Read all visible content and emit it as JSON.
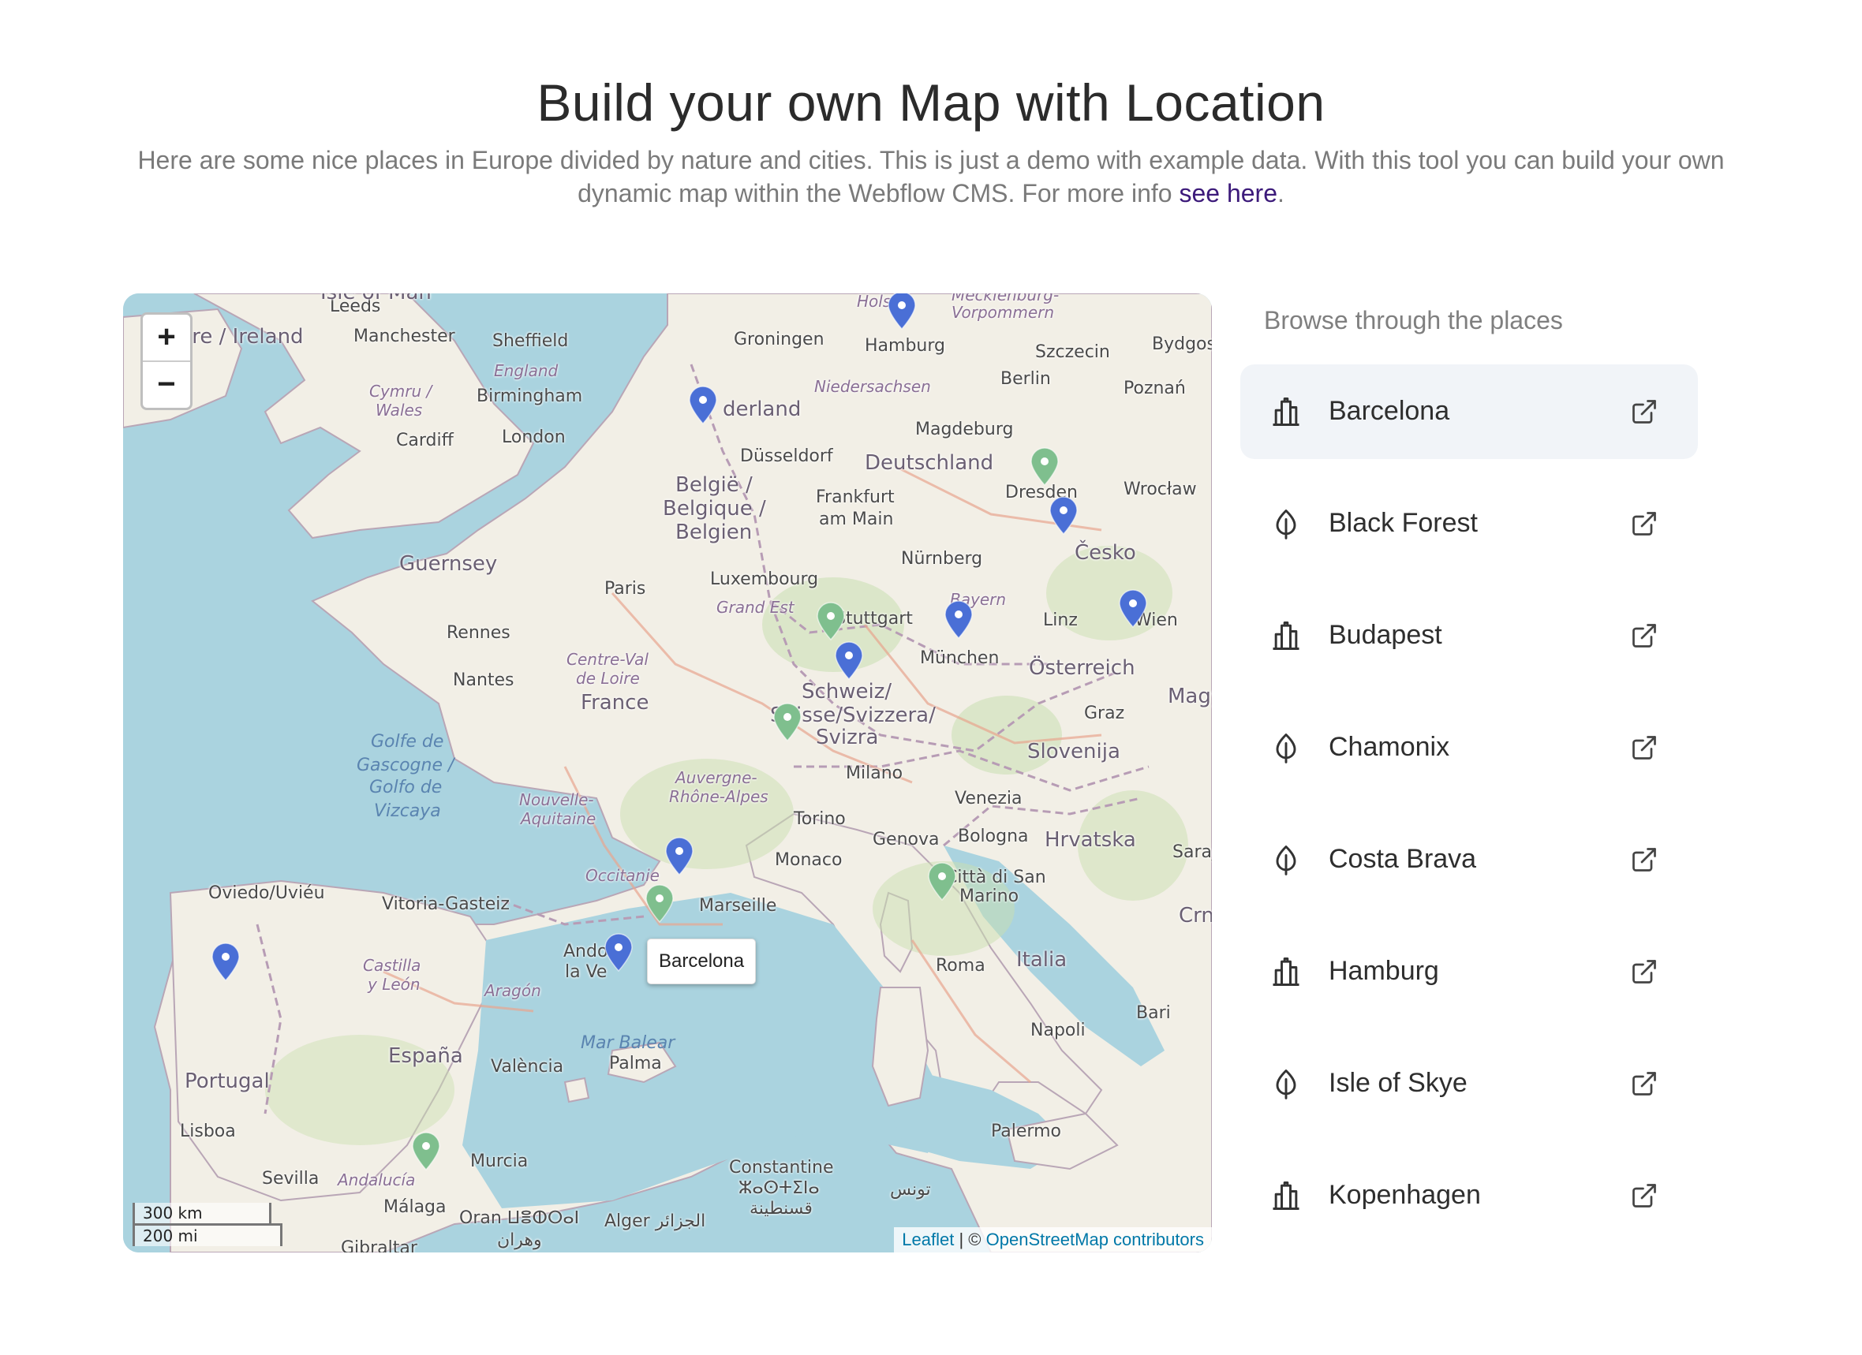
{
  "header": {
    "title": "Build your own Map with Location",
    "subtitle_before": "Here are some nice places in Europe divided by nature and cities. This is just a demo with example data. With this tool you can build your own dynamic map within the Webflow CMS. For more info ",
    "link_text": "see here",
    "subtitle_after": "."
  },
  "map": {
    "zoom_in": "+",
    "zoom_out": "−",
    "scale_km": "300 km",
    "scale_mi": "200 mi",
    "attribution_leaflet": "Leaflet",
    "attribution_sep": " | © ",
    "attribution_osm": "OpenStreetMap contributors",
    "tooltip": "Barcelona",
    "city_color": "#4a6fd6",
    "nature_color": "#7fbf8e",
    "water_color": "#aad3df",
    "land_color": "#f2efe6",
    "labels": {
      "leeds": "Leeds",
      "isle_of_man": "Isle of Man",
      "ireland": "ire / Ireland",
      "manchester": "Manchester",
      "sheffield": "Sheffield",
      "england": "England",
      "cymru": "Cymru /",
      "wales": "Wales",
      "birmingham": "Birmingham",
      "cardiff": "Cardiff",
      "london": "London",
      "guernsey": "Guernsey",
      "groningen": "Groningen",
      "hamburg": "Hamburg",
      "holst": "Holst",
      "mecklenburg": "Mecklenburg-",
      "vorpommern": "Vorpommern",
      "szczecin": "Szczecin",
      "bydgos": "Bydgos",
      "nederland": "derland",
      "niedersachsen": "Niedersachsen",
      "berlin": "Berlin",
      "poznan": "Poznań",
      "magdeburg": "Magdeburg",
      "dusseldorf": "Düsseldorf",
      "deutschland": "Deutschland",
      "belgie1": "België /",
      "belgie2": "Belgique /",
      "belgie3": "Belgien",
      "frankfurt1": "Frankfurt",
      "frankfurt2": "am Main",
      "dresden": "Dresden",
      "wroclaw": "Wrocław",
      "nurnberg": "Nürnberg",
      "cesko": "Česko",
      "luxembourg": "Luxembourg",
      "paris": "Paris",
      "grand_est": "Grand Est",
      "stuttgart": "Stuttgart",
      "bayern": "Bayern",
      "linz": "Linz",
      "wien": "Wien",
      "rennes": "Rennes",
      "centre1": "Centre-Val",
      "centre2": "de Loire",
      "munchen": "München",
      "osterreich": "Österreich",
      "nantes": "Nantes",
      "schweiz1": "Schweiz/",
      "schweiz2": "Suisse/Svizzera/",
      "schweiz3": "Svizra",
      "france": "France",
      "magy": "Magy",
      "graz": "Graz",
      "golfe1": "Golfe de",
      "golfe2": "Gascogne /",
      "golfe3": "Golfo de",
      "golfe4": "Vizcaya",
      "slovenija": "Slovenija",
      "auvergne1": "Auvergne-",
      "auvergne2": "Rhône-Alpes",
      "milano": "Milano",
      "nouvelle1": "Nouvelle-",
      "nouvelle2": "Aquitaine",
      "venezia": "Venezia",
      "torino": "Torino",
      "hrvatska": "Hrvatska",
      "genova": "Genova",
      "bologna": "Bologna",
      "saraj": "Saraj",
      "monaco": "Monaco",
      "occitanie": "Occitanie",
      "sanmarino1": "Città di San",
      "sanmarino2": "Marino",
      "oviedo": "Oviedo/Uviéu",
      "vitoria": "Vitoria-Gasteiz",
      "marseille": "Marseille",
      "crn": "Crn",
      "andorra": "Andor",
      "lavella": "la Ve",
      "italia": "Italia",
      "cyl1": "Castilla",
      "cyl2": "y León",
      "aragon": "Aragón",
      "roma": "Roma",
      "bari": "Bari",
      "mar_balear": "Mar Balear",
      "napoli": "Napoli",
      "espana": "España",
      "palma": "Palma",
      "valencia": "València",
      "portugal": "Portugal",
      "lisboa": "Lisboa",
      "palermo": "Palermo",
      "murcia": "Murcia",
      "constantine1": "Constantine",
      "constantine2": "ⵣⴰⵙⵜⵉⵏⴰ",
      "sevilla": "Sevilla",
      "andalucia": "Andalucía",
      "malaga": "Málaga",
      "oran1": "Oran ⵡⴻⵀⵔⴰⵏ",
      "oran2": "وهران",
      "alger": "Alger الجزائر",
      "qacentina": "قسنطينة",
      "tunis": "تونس",
      "gibraltar": "Gibraltar"
    }
  },
  "sidebar": {
    "heading": "Browse through the places",
    "places": [
      {
        "name": "Barcelona",
        "type": "city",
        "icon": "city-icon",
        "active": true
      },
      {
        "name": "Black Forest",
        "type": "nature",
        "icon": "leaf-icon",
        "active": false
      },
      {
        "name": "Budapest",
        "type": "city",
        "icon": "city-icon",
        "active": false
      },
      {
        "name": "Chamonix",
        "type": "nature",
        "icon": "leaf-icon",
        "active": false
      },
      {
        "name": "Costa Brava",
        "type": "nature",
        "icon": "leaf-icon",
        "active": false
      },
      {
        "name": "Hamburg",
        "type": "city",
        "icon": "city-icon",
        "active": false
      },
      {
        "name": "Isle of Skye",
        "type": "nature",
        "icon": "leaf-icon",
        "active": false
      },
      {
        "name": "Kopenhagen",
        "type": "city",
        "icon": "city-icon",
        "active": false
      }
    ]
  }
}
